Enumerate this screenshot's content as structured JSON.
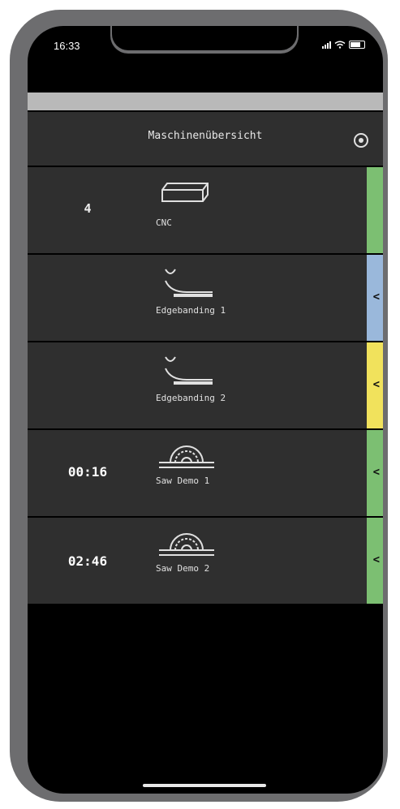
{
  "status_bar": {
    "time": "16:33"
  },
  "header": {
    "title": "Maschinenübersicht"
  },
  "colors": {
    "green": "#7cbf72",
    "blue": "#9ab8db",
    "yellow": "#f1e25c"
  },
  "machines": [
    {
      "count": "4",
      "timer": "",
      "progress": 0,
      "icon": "cnc-icon",
      "label": "CNC",
      "status_color": "#7cbf72",
      "chevron": ""
    },
    {
      "count": "",
      "timer": "",
      "progress": 0,
      "icon": "edgebanding-icon",
      "label": "Edgebanding 1",
      "status_color": "#9ab8db",
      "chevron": "<"
    },
    {
      "count": "",
      "timer": "",
      "progress": 0,
      "icon": "edgebanding-icon",
      "label": "Edgebanding 2",
      "status_color": "#f1e25c",
      "chevron": "<"
    },
    {
      "count": "",
      "timer": "00:16",
      "progress": 1.0,
      "icon": "saw-icon",
      "label": "Saw Demo 1",
      "status_color": "#7cbf72",
      "chevron": "<"
    },
    {
      "count": "",
      "timer": "02:46",
      "progress": 1.0,
      "icon": "saw-icon",
      "label": "Saw Demo 2",
      "status_color": "#7cbf72",
      "chevron": "<"
    }
  ]
}
